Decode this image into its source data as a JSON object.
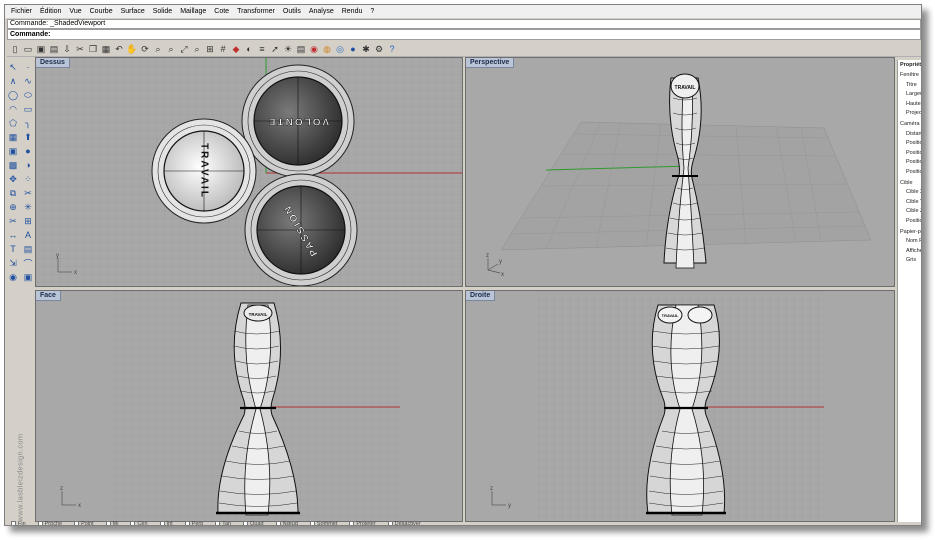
{
  "menu": [
    "Fichier",
    "Édition",
    "Vue",
    "Courbe",
    "Surface",
    "Solide",
    "Maillage",
    "Cote",
    "Transformer",
    "Outils",
    "Analyse",
    "Rendu",
    "?"
  ],
  "command": {
    "history": "Commande: _ShadedViewport",
    "prompt": "Commande:"
  },
  "toolbar_icons": [
    "new-file-icon",
    "open-folder-icon",
    "save-icon",
    "print-icon",
    "import-icon",
    "cut-icon",
    "copy-icon",
    "paste-icon",
    "undo-icon",
    "pan-icon",
    "rotate-view-icon",
    "zoom-icon",
    "zoom-window-icon",
    "zoom-extents-icon",
    "zoom-selected-icon",
    "four-viewports-icon",
    "grid-icon",
    "car-icon",
    "hide-icon",
    "layer-icon",
    "select-icon",
    "lightbulb-icon",
    "properties-icon",
    "render-icon",
    "color-wheel-icon",
    "material-icon",
    "sphere-icon",
    "settings-icon",
    "gear-icon",
    "help-icon"
  ],
  "left_tools": [
    "select-arrow-icon",
    "point-icon",
    "polyline-icon",
    "curve-icon",
    "circle-icon",
    "ellipse-icon",
    "arc-icon",
    "rectangle-icon",
    "polygon-icon",
    "fillet-icon",
    "surface-icon",
    "extrude-icon",
    "box-icon",
    "sphere-tool-icon",
    "mesh-icon",
    "boolean-icon",
    "transform-icon",
    "array-icon",
    "offset-icon",
    "split-icon",
    "join-icon",
    "explode-icon",
    "trim-icon",
    "group-icon",
    "dimension-icon",
    "text-icon",
    "text-tool-icon",
    "layout-icon",
    "scale-icon",
    "analyze-icon",
    "render-tool-icon",
    "snapshot-icon"
  ],
  "viewports": {
    "top": {
      "title": "Dessus",
      "labels": [
        "TRAVAIL",
        "VOLONTE",
        "PASSION"
      ],
      "axis": [
        "y",
        "x"
      ]
    },
    "perspective": {
      "title": "Perspective",
      "labels": [
        "TRAVAIL"
      ],
      "axis": [
        "z",
        "y",
        "x"
      ]
    },
    "front": {
      "title": "Face",
      "labels": [
        "TRAVAIL"
      ],
      "axis": [
        "z",
        "x"
      ]
    },
    "right": {
      "title": "Droite",
      "labels": [
        "TRAVAIL"
      ],
      "axis": [
        "z",
        "y"
      ]
    }
  },
  "properties": {
    "header": "Propriét",
    "items": [
      "Fenêtre",
      "Titre",
      "Largeu",
      "Hauteu",
      "Project",
      "Caméra",
      "Distan",
      "Positio",
      "Positio",
      "Positio",
      "Positio",
      "Cible",
      "Cible X",
      "Cible Y",
      "Cible Z",
      "Positio",
      "Papier-pe",
      "Nom F",
      "Afficher",
      "Gris"
    ]
  },
  "watermark": "www.lasbleizdesign.com",
  "status_osnaps": [
    "Fin",
    "Proche",
    "Point",
    "Mi",
    "Cen",
    "Int",
    "Perp",
    "Tan",
    "Quad",
    "Nœud",
    "Sommet",
    "Projeter",
    "Désactiver"
  ],
  "colors": {
    "viewport_bg": "#a8a8a8",
    "grid_line": "#8f8f8f",
    "axis_x": "#b03030",
    "axis_y": "#2f9a2f",
    "title_bg": "#b9c4d6"
  }
}
